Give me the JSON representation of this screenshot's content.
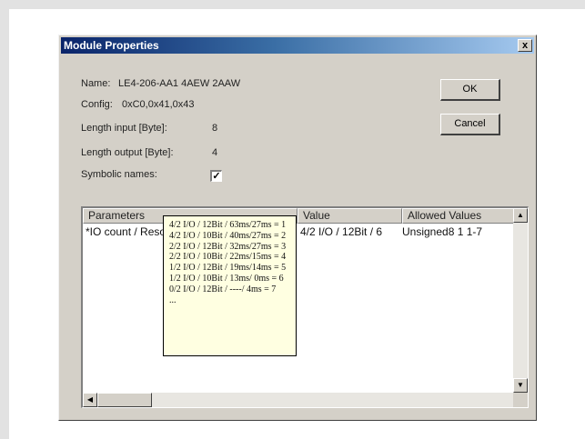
{
  "dialog": {
    "title": "Module Properties",
    "close_glyph": "x",
    "name_label": "Name:",
    "name_value": "LE4-206-AA1 4AEW 2AAW",
    "config_label": "Config:",
    "config_value": "0xC0,0x41,0x43",
    "len_in_label": "Length input [Byte]:",
    "len_in_value": "8",
    "len_out_label": "Length output [Byte]:",
    "len_out_value": "4",
    "symbolic_label": "Symbolic names:",
    "symbolic_checked": "✓",
    "ok_label": "OK",
    "cancel_label": "Cancel"
  },
  "grid": {
    "headers": [
      "Parameters",
      "Value",
      "Allowed Values"
    ],
    "row": {
      "parameter": "*IO count / Resolution / IO scan",
      "value": "4/2 I/O / 12Bit / 6",
      "allowed": "Unsigned8 1 1-7"
    },
    "scroll_up": "▲",
    "scroll_down": "▼",
    "scroll_left": "◀"
  },
  "tooltip": {
    "lines": [
      "4/2 I/O / 12Bit / 63ms/27ms = 1",
      "4/2 I/O / 10Bit / 40ms/27ms = 2",
      "2/2 I/O / 12Bit / 32ms/27ms = 3",
      "2/2 I/O / 10Bit / 22ms/15ms = 4",
      "1/2 I/O / 12Bit / 19ms/14ms = 5",
      "1/2 I/O / 10Bit / 13ms/ 0ms = 6",
      "0/2 I/O / 12Bit / ----/ 4ms = 7",
      "..."
    ]
  }
}
